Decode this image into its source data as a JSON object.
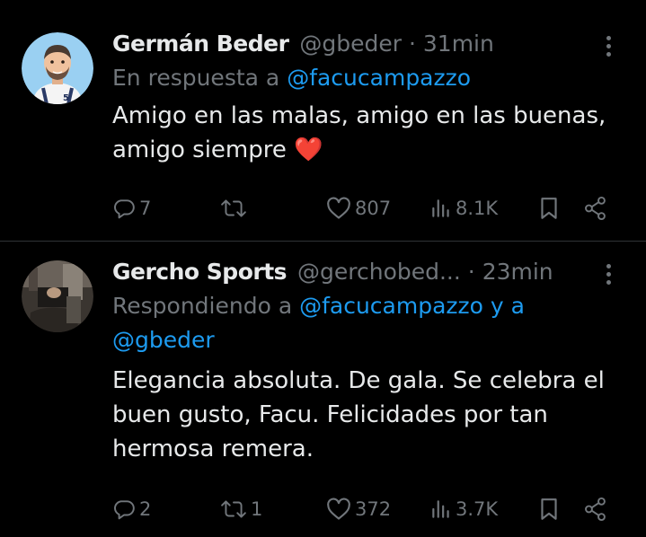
{
  "tweets": [
    {
      "display_name": "Germán Beder",
      "handle": "@gbeder",
      "separator": "·",
      "time": "31min",
      "reply_prefix": "En respuesta a ",
      "reply_mentions": "@facucampazzo",
      "text": "Amigo en las malas, amigo en las buenas, amigo siempre",
      "emoji": "❤️",
      "actions": {
        "replies": "7",
        "retweets": "",
        "likes": "807",
        "views": "8.1K"
      }
    },
    {
      "display_name": "Gercho Sports",
      "handle": "@gerchobed...",
      "separator": "·",
      "time": "23min",
      "reply_prefix": "Respondiendo a ",
      "reply_mentions": "@facucampazzo y a @gbeder",
      "text": "Elegancia absoluta. De gala. Se celebra el buen gusto, Facu. Felicidades por tan hermosa remera.",
      "emoji": "",
      "actions": {
        "replies": "2",
        "retweets": "1",
        "likes": "372",
        "views": "3.7K"
      }
    }
  ],
  "colors": {
    "background": "#000000",
    "text": "#e7e9ea",
    "secondary": "#71767b",
    "accent": "#1d9bf0",
    "divider": "#2f3336",
    "heart_emoji": "#e0245e"
  },
  "icons": {
    "reply": "reply-icon",
    "retweet": "retweet-icon",
    "like": "heart-icon",
    "views": "views-icon",
    "bookmark": "bookmark-icon",
    "share": "share-icon",
    "more": "more-vertical-icon"
  }
}
